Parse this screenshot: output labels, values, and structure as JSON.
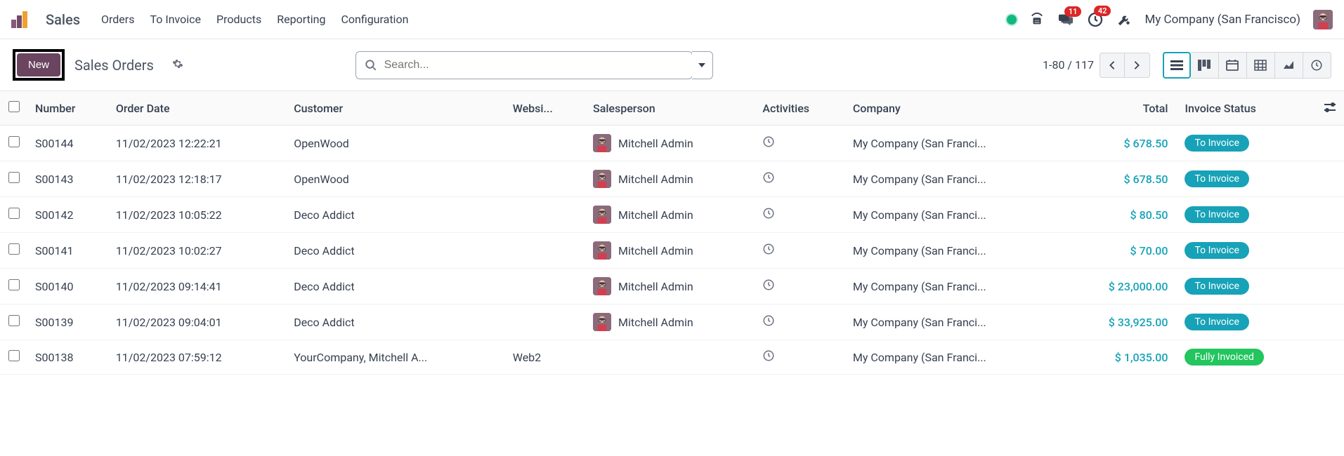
{
  "nav": {
    "app_name": "Sales",
    "links": [
      "Orders",
      "To Invoice",
      "Products",
      "Reporting",
      "Configuration"
    ],
    "badges": {
      "messages": "11",
      "activities": "42"
    },
    "company": "My Company (San Francisco)"
  },
  "control": {
    "new_label": "New",
    "breadcrumb": "Sales Orders",
    "search_placeholder": "Search...",
    "pager": "1-80 / 117"
  },
  "columns": [
    "Number",
    "Order Date",
    "Customer",
    "Websi...",
    "Salesperson",
    "Activities",
    "Company",
    "Total",
    "Invoice Status"
  ],
  "rows": [
    {
      "number": "S00144",
      "date": "11/02/2023 12:22:21",
      "customer": "OpenWood",
      "website": "",
      "salesperson": "Mitchell Admin",
      "has_sp_avatar": true,
      "company": "My Company (San Franci...",
      "total": "$ 678.50",
      "status": "To Invoice",
      "status_class": "status-to-invoice"
    },
    {
      "number": "S00143",
      "date": "11/02/2023 12:18:17",
      "customer": "OpenWood",
      "website": "",
      "salesperson": "Mitchell Admin",
      "has_sp_avatar": true,
      "company": "My Company (San Franci...",
      "total": "$ 678.50",
      "status": "To Invoice",
      "status_class": "status-to-invoice"
    },
    {
      "number": "S00142",
      "date": "11/02/2023 10:05:22",
      "customer": "Deco Addict",
      "website": "",
      "salesperson": "Mitchell Admin",
      "has_sp_avatar": true,
      "company": "My Company (San Franci...",
      "total": "$ 80.50",
      "status": "To Invoice",
      "status_class": "status-to-invoice"
    },
    {
      "number": "S00141",
      "date": "11/02/2023 10:02:27",
      "customer": "Deco Addict",
      "website": "",
      "salesperson": "Mitchell Admin",
      "has_sp_avatar": true,
      "company": "My Company (San Franci...",
      "total": "$ 70.00",
      "status": "To Invoice",
      "status_class": "status-to-invoice"
    },
    {
      "number": "S00140",
      "date": "11/02/2023 09:14:41",
      "customer": "Deco Addict",
      "website": "",
      "salesperson": "Mitchell Admin",
      "has_sp_avatar": true,
      "company": "My Company (San Franci...",
      "total": "$ 23,000.00",
      "status": "To Invoice",
      "status_class": "status-to-invoice"
    },
    {
      "number": "S00139",
      "date": "11/02/2023 09:04:01",
      "customer": "Deco Addict",
      "website": "",
      "salesperson": "Mitchell Admin",
      "has_sp_avatar": true,
      "company": "My Company (San Franci...",
      "total": "$ 33,925.00",
      "status": "To Invoice",
      "status_class": "status-to-invoice"
    },
    {
      "number": "S00138",
      "date": "11/02/2023 07:59:12",
      "customer": "YourCompany, Mitchell A...",
      "website": "Web2",
      "salesperson": "",
      "has_sp_avatar": false,
      "company": "My Company (San Franci...",
      "total": "$ 1,035.00",
      "status": "Fully Invoiced",
      "status_class": "status-fully-invoiced"
    }
  ]
}
